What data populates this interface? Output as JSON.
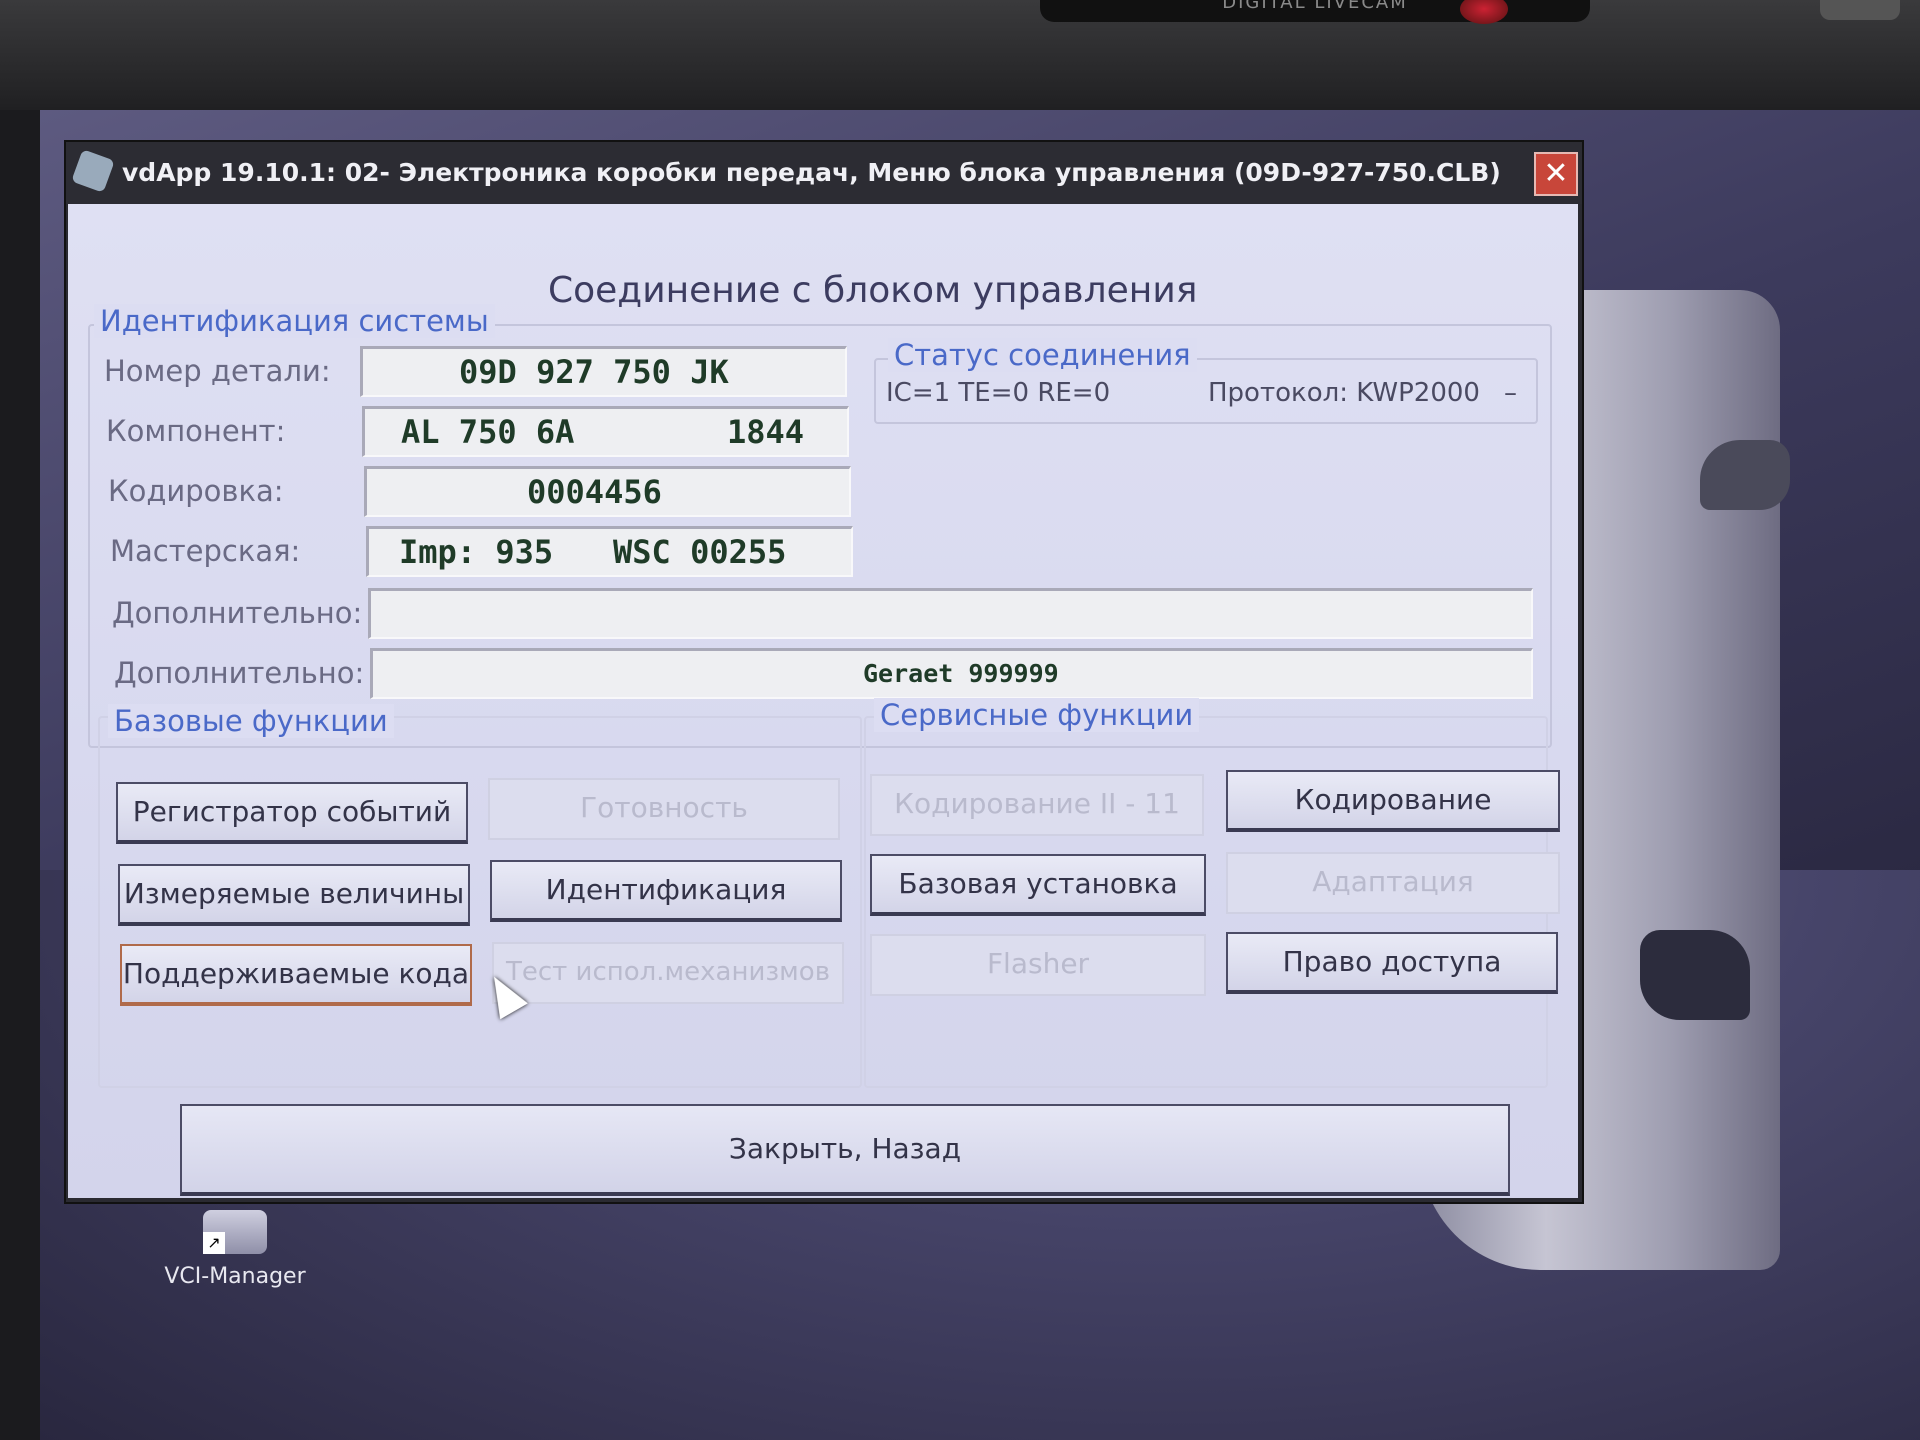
{
  "bezel": {
    "badge": "DIGITAL LIVECAM"
  },
  "window": {
    "title": "vdApp 19.10.1: 02- Электроника коробки передач,  Меню блока управления (09D-927-750.CLB)",
    "close_symbol": "✕"
  },
  "heading": "Соединение с блоком управления",
  "identification": {
    "group_label": "Идентификация системы",
    "part_number_label": "Номер детали:",
    "part_number_value": "09D 927 750 JK",
    "component_label": "Компонент:",
    "component_value": "AL 750 6A",
    "component_number": "1844",
    "coding_label": "Кодировка:",
    "coding_value": "0004456",
    "workshop_label": "Мастерская:",
    "workshop_imp": "Imp: 935",
    "workshop_wsc": "WSC 00255",
    "extra1_label": "Дополнительно:",
    "extra1_value": "",
    "extra2_label": "Дополнительно:",
    "extra2_value": "Geraet 999999"
  },
  "connection_status": {
    "group_label": "Статус соединения",
    "counters": "IC=1  TE=0   RE=0",
    "protocol": "Протокол: KWP2000",
    "dash": "–"
  },
  "basic_functions": {
    "group_label": "Базовые функции",
    "buttons": [
      {
        "label": "Регистратор событий",
        "enabled": true
      },
      {
        "label": "Готовность",
        "enabled": false
      },
      {
        "label": "Измеряемые величины",
        "enabled": true
      },
      {
        "label": "Идентификация",
        "enabled": true
      },
      {
        "label": "Поддерживаемые кода",
        "enabled": true
      },
      {
        "label": "Тест испол.механизмов",
        "enabled": false
      }
    ]
  },
  "service_functions": {
    "group_label": "Сервисные функции",
    "buttons": [
      {
        "label": "Кодирование II - 11",
        "enabled": false
      },
      {
        "label": "Кодирование",
        "enabled": true
      },
      {
        "label": "Базовая установка",
        "enabled": true
      },
      {
        "label": "Адаптация",
        "enabled": false
      },
      {
        "label": "Flasher",
        "enabled": false
      },
      {
        "label": "Право доступа",
        "enabled": true
      }
    ]
  },
  "close_back_label": "Закрыть, Назад",
  "desktop": {
    "icon_label": "VCI-Manager"
  },
  "colors": {
    "dialog_bg": "#dfe0f3",
    "group_label": "#4a69c8",
    "field_value": "#1f3b28",
    "close_button": "#c8463a"
  }
}
